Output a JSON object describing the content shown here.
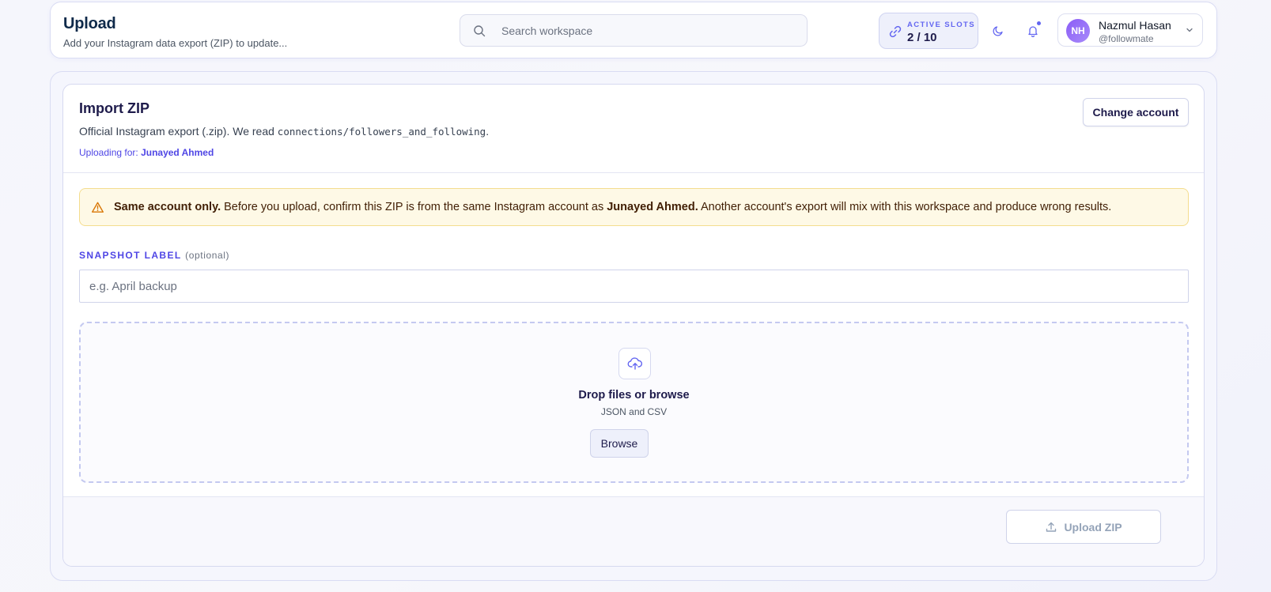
{
  "header": {
    "title": "Upload",
    "subtitle": "Add your Instagram data export (ZIP) to update...",
    "search_placeholder": "Search workspace",
    "slots_label": "ACTIVE SLOTS",
    "slots_value": "2 / 10",
    "user": {
      "initials": "NH",
      "name": "Nazmul Hasan",
      "handle": "@followmate"
    }
  },
  "card": {
    "title": "Import ZIP",
    "desc_prefix": "Official Instagram export (.zip). We read ",
    "desc_code": "connections/followers_and_following",
    "desc_suffix": ".",
    "uploading_for_label": "Uploading for:",
    "uploading_for_name": "Junayed Ahmed",
    "change_account": "Change account"
  },
  "warning": {
    "strong": "Same account only.",
    "text_1": " Before you upload, confirm this ZIP is from the same Instagram account as ",
    "account": "Junayed Ahmed.",
    "text_2": " Another account's export will mix with this workspace and produce wrong results."
  },
  "snapshot": {
    "label": "SNAPSHOT LABEL",
    "optional": "(optional)",
    "placeholder": "e.g. April backup"
  },
  "dropzone": {
    "title": "Drop files or browse",
    "subtitle": "JSON and CSV",
    "browse": "Browse"
  },
  "footer": {
    "upload": "Upload ZIP"
  },
  "colors": {
    "accent": "#6366f1",
    "warning_bg": "#fef9e6",
    "avatar": "#8b5cf6"
  }
}
